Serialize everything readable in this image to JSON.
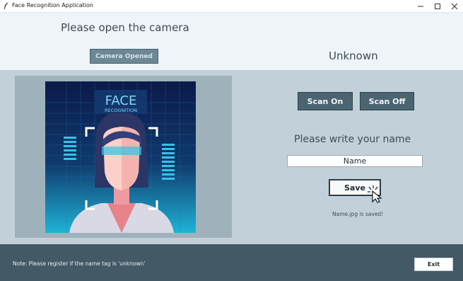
{
  "window": {
    "title": "Face Recognition Application",
    "min_icon": "minimize-icon",
    "max_icon": "maximize-icon",
    "close_icon": "close-icon"
  },
  "header": {
    "prompt": "Please open the camera",
    "camera_button": "Camera Opened",
    "recognized_name": "Unknown"
  },
  "preview": {
    "image_title": "FACE",
    "image_subtitle": "RECOGNITION"
  },
  "controls": {
    "scan_on": "Scan On",
    "scan_off": "Scan Off",
    "name_prompt": "Please write your name",
    "name_value": "Name",
    "save_label": "Save",
    "saved_message": "Name.jpg is saved!"
  },
  "footer": {
    "note": "Note: Please register if the name tag is  'unknown'",
    "exit_label": "Exit"
  },
  "colors": {
    "header_bg": "#eef4f8",
    "main_bg": "#c2d1d9",
    "footer_bg": "#435a66",
    "button_bg": "#4b6470",
    "accent_cyan": "#1fb3d6"
  }
}
